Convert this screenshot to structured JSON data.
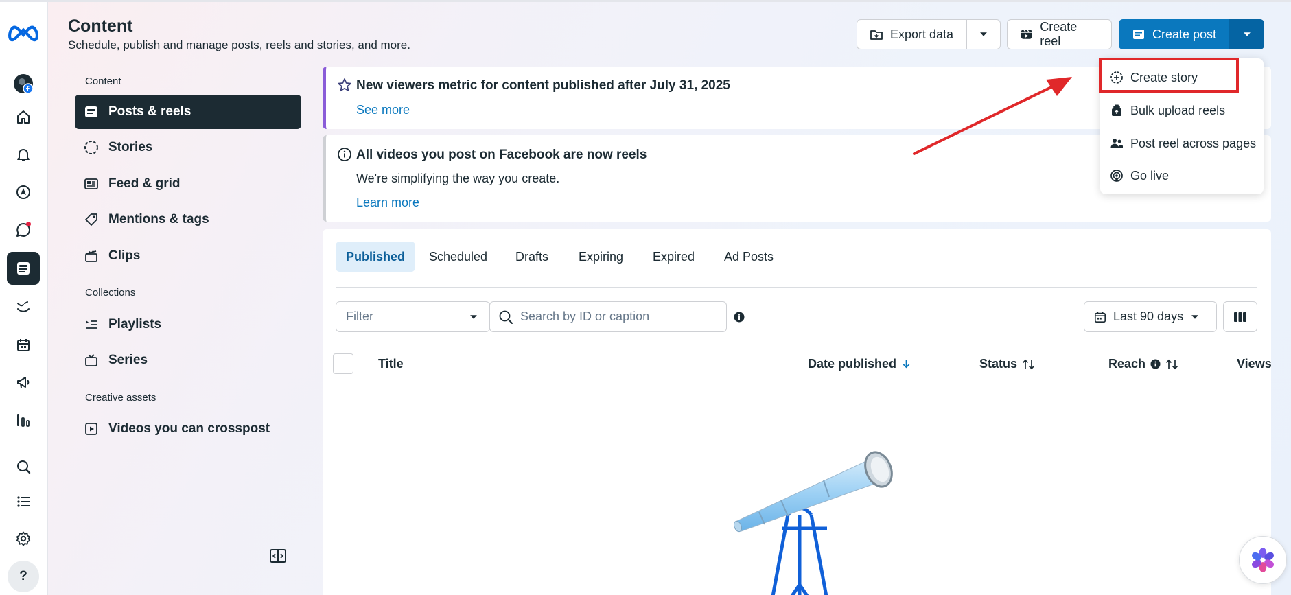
{
  "header": {
    "title": "Content",
    "subtitle": "Schedule, publish and manage posts, reels and stories, and more.",
    "export_label": "Export data",
    "create_reel_label": "Create reel",
    "create_post_label": "Create post"
  },
  "nav": {
    "section_content": "Content",
    "section_collections": "Collections",
    "section_creative": "Creative assets",
    "items": [
      {
        "label": "Posts & reels",
        "icon": "posts-icon"
      },
      {
        "label": "Stories",
        "icon": "stories-icon"
      },
      {
        "label": "Feed & grid",
        "icon": "feed-grid-icon"
      },
      {
        "label": "Mentions & tags",
        "icon": "tag-icon"
      },
      {
        "label": "Clips",
        "icon": "clapper-icon"
      },
      {
        "label": "Playlists",
        "icon": "playlist-icon"
      },
      {
        "label": "Series",
        "icon": "tv-icon"
      },
      {
        "label": "Videos you can crosspost",
        "icon": "play-square-icon"
      }
    ]
  },
  "banners": {
    "viewers_title": "New viewers metric for content published after July 31, 2025",
    "viewers_link": "See more",
    "reels_title": "All videos you post on Facebook are now reels",
    "reels_text": "We're simplifying the way you create.",
    "reels_link": "Learn more"
  },
  "tabs": [
    "Published",
    "Scheduled",
    "Drafts",
    "Expiring",
    "Expired",
    "Ad Posts"
  ],
  "filters": {
    "filter_placeholder": "Filter",
    "search_placeholder": "Search by ID or caption",
    "date_range": "Last 90 days"
  },
  "table": {
    "columns": [
      "Title",
      "Date published",
      "Status",
      "Reach",
      "Views"
    ]
  },
  "dropdown": {
    "items": [
      {
        "label": "Create story",
        "icon": "plus-circle-icon"
      },
      {
        "label": "Bulk upload reels",
        "icon": "stack-upload-icon"
      },
      {
        "label": "Post reel across pages",
        "icon": "people-icon"
      },
      {
        "label": "Go live",
        "icon": "live-icon"
      }
    ]
  },
  "colors": {
    "accent": "#0a78be",
    "dark": "#1c2b33",
    "highlight": "#e0282a",
    "banner_purple": "#8a5cd8"
  },
  "rail": {
    "help_label": "?"
  }
}
